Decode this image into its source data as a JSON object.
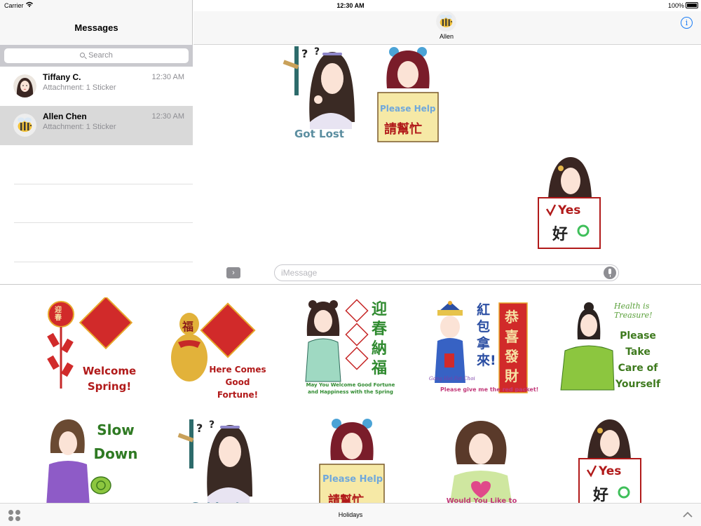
{
  "status": {
    "carrier": "Carrier",
    "time": "12:30 AM",
    "battery": "100%"
  },
  "sidebar": {
    "title": "Messages",
    "search_placeholder": "Search",
    "conversations": [
      {
        "name": "Tiffany C.",
        "preview": "Attachment: 1 Sticker",
        "time": "12:30 AM"
      },
      {
        "name": "Allen Chen",
        "preview": "Attachment: 1 Sticker",
        "time": "12:30 AM"
      }
    ]
  },
  "conversation": {
    "contact_name": "Allen",
    "input_placeholder": "iMessage",
    "sent_stickers": [
      {
        "caption": "Got Lost"
      },
      {
        "caption": "Please Help",
        "caption_cn": "請幫忙"
      },
      {
        "caption": "Yes",
        "caption_cn": "好"
      }
    ]
  },
  "drawer": {
    "label": "Holidays",
    "stickers": [
      {
        "caption": "Welcome Spring!",
        "label_cn": "迎春"
      },
      {
        "caption": "Here Comes Good Fortune!",
        "label_cn": "福"
      },
      {
        "caption": "May You Welcome Good Fortune and Happiness with the Spring",
        "label_cn": "迎春納福"
      },
      {
        "caption": "Please give me the red packet!",
        "label_cn": "紅包拿來!",
        "label_cn2": "恭喜發財",
        "label_script": "Gong Hei Fat Choi"
      },
      {
        "caption": "Please Take Care of Yourself",
        "label_script": "Health is Treasure!"
      },
      {
        "caption": "Slow Down"
      },
      {
        "caption": "Got Lost"
      },
      {
        "caption": "Please Help",
        "label_cn": "請幫忙"
      },
      {
        "caption": "Would You Like to"
      },
      {
        "caption": "Yes",
        "label_cn": "好"
      }
    ]
  },
  "colors": {
    "accent": "#1a7cf5",
    "selected_row": "#d9d9d9",
    "caption_green": "#3e8a2c",
    "caption_red": "#b11a1a"
  }
}
